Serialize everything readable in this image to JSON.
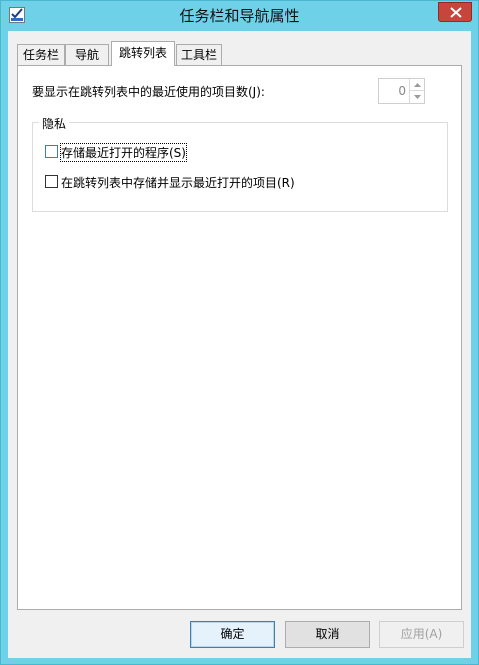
{
  "window": {
    "title": "任务栏和导航属性"
  },
  "tabs": [
    {
      "label": "任务栏"
    },
    {
      "label": "导航"
    },
    {
      "label": "跳转列表"
    },
    {
      "label": "工具栏"
    }
  ],
  "active_tab": "跳转列表",
  "jumplist": {
    "recent_count_label": "要显示在跳转列表中的最近使用的项目数(J):",
    "recent_count_value": "0"
  },
  "privacy": {
    "title": "隐私",
    "options": [
      {
        "label": "存储最近打开的程序(S)",
        "checked": false
      },
      {
        "label": "在跳转列表中存储并显示最近打开的项目(R)",
        "checked": false
      }
    ]
  },
  "buttons": {
    "ok": "确定",
    "cancel": "取消",
    "apply": "应用(A)"
  },
  "icons": {
    "app": "checkbox-app-icon",
    "close": "close-icon"
  },
  "colors": {
    "frame": "#6fd1e8",
    "close": "#c7463b"
  }
}
